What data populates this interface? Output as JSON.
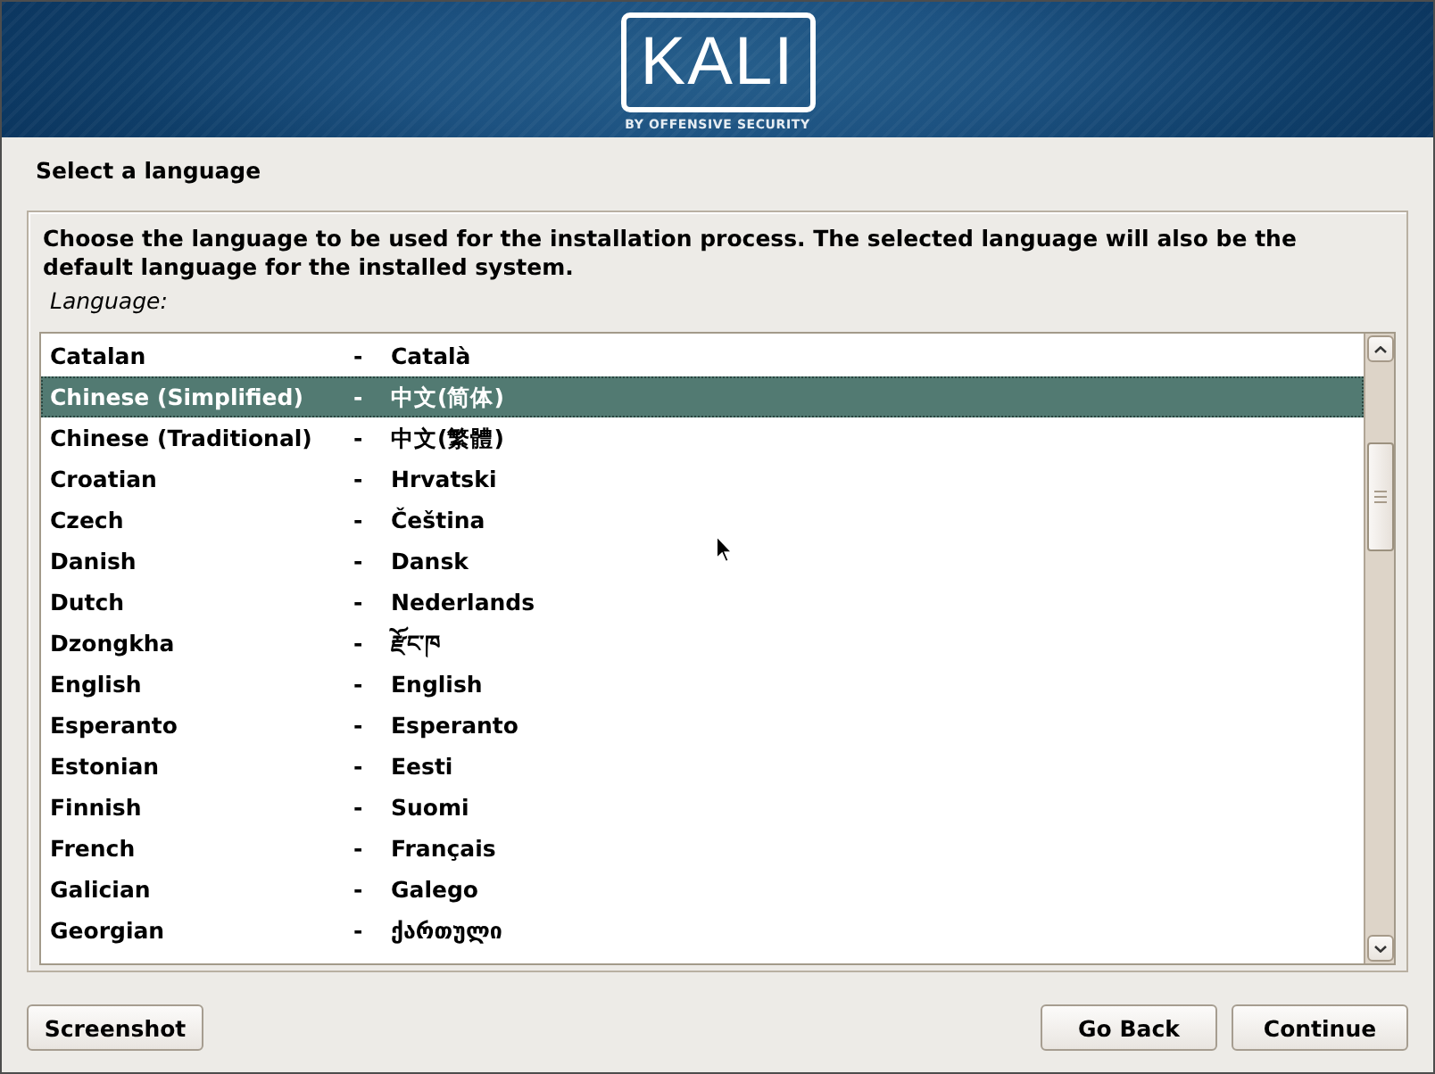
{
  "banner": {
    "logo_text": "KALI",
    "tagline": "BY OFFENSIVE SECURITY"
  },
  "title": "Select a language",
  "panel": {
    "instructions": "Choose the language to be used for the installation process. The selected language will also be the default language for the installed system.",
    "list_label": "Language:",
    "languages": [
      {
        "name": "Catalan",
        "separator": "-",
        "native": "Català",
        "selected": false
      },
      {
        "name": "Chinese (Simplified)",
        "separator": "-",
        "native": "中文(简体)",
        "selected": true
      },
      {
        "name": "Chinese (Traditional)",
        "separator": "-",
        "native": "中文(繁體)",
        "selected": false
      },
      {
        "name": "Croatian",
        "separator": "-",
        "native": "Hrvatski",
        "selected": false
      },
      {
        "name": "Czech",
        "separator": "-",
        "native": "Čeština",
        "selected": false
      },
      {
        "name": "Danish",
        "separator": "-",
        "native": "Dansk",
        "selected": false
      },
      {
        "name": "Dutch",
        "separator": "-",
        "native": "Nederlands",
        "selected": false
      },
      {
        "name": "Dzongkha",
        "separator": "-",
        "native": "རྫོང་ཁ",
        "selected": false
      },
      {
        "name": "English",
        "separator": "-",
        "native": "English",
        "selected": false
      },
      {
        "name": "Esperanto",
        "separator": "-",
        "native": "Esperanto",
        "selected": false
      },
      {
        "name": "Estonian",
        "separator": "-",
        "native": "Eesti",
        "selected": false
      },
      {
        "name": "Finnish",
        "separator": "-",
        "native": "Suomi",
        "selected": false
      },
      {
        "name": "French",
        "separator": "-",
        "native": "Français",
        "selected": false
      },
      {
        "name": "Galician",
        "separator": "-",
        "native": "Galego",
        "selected": false
      },
      {
        "name": "Georgian",
        "separator": "-",
        "native": "ქართული",
        "selected": false
      }
    ]
  },
  "screenshot_button": "Screenshot",
  "navigation_buttons": [
    "Go Back",
    "Continue"
  ]
}
